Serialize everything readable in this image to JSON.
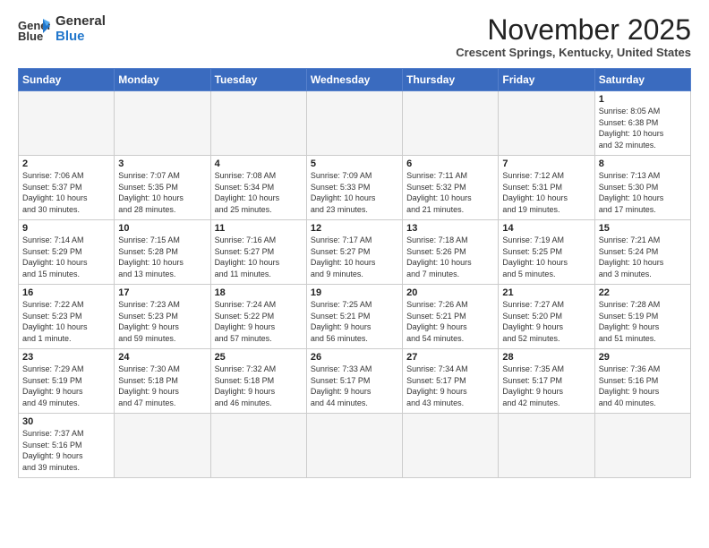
{
  "logo": {
    "line1": "General",
    "line2": "Blue"
  },
  "title": "November 2025",
  "location": "Crescent Springs, Kentucky, United States",
  "days_of_week": [
    "Sunday",
    "Monday",
    "Tuesday",
    "Wednesday",
    "Thursday",
    "Friday",
    "Saturday"
  ],
  "weeks": [
    [
      {
        "day": "",
        "info": "",
        "empty": true
      },
      {
        "day": "",
        "info": "",
        "empty": true
      },
      {
        "day": "",
        "info": "",
        "empty": true
      },
      {
        "day": "",
        "info": "",
        "empty": true
      },
      {
        "day": "",
        "info": "",
        "empty": true
      },
      {
        "day": "",
        "info": "",
        "empty": true
      },
      {
        "day": "1",
        "info": "Sunrise: 8:05 AM\nSunset: 6:38 PM\nDaylight: 10 hours\nand 32 minutes."
      }
    ],
    [
      {
        "day": "2",
        "info": "Sunrise: 7:06 AM\nSunset: 5:37 PM\nDaylight: 10 hours\nand 30 minutes."
      },
      {
        "day": "3",
        "info": "Sunrise: 7:07 AM\nSunset: 5:35 PM\nDaylight: 10 hours\nand 28 minutes."
      },
      {
        "day": "4",
        "info": "Sunrise: 7:08 AM\nSunset: 5:34 PM\nDaylight: 10 hours\nand 25 minutes."
      },
      {
        "day": "5",
        "info": "Sunrise: 7:09 AM\nSunset: 5:33 PM\nDaylight: 10 hours\nand 23 minutes."
      },
      {
        "day": "6",
        "info": "Sunrise: 7:11 AM\nSunset: 5:32 PM\nDaylight: 10 hours\nand 21 minutes."
      },
      {
        "day": "7",
        "info": "Sunrise: 7:12 AM\nSunset: 5:31 PM\nDaylight: 10 hours\nand 19 minutes."
      },
      {
        "day": "8",
        "info": "Sunrise: 7:13 AM\nSunset: 5:30 PM\nDaylight: 10 hours\nand 17 minutes."
      }
    ],
    [
      {
        "day": "9",
        "info": "Sunrise: 7:14 AM\nSunset: 5:29 PM\nDaylight: 10 hours\nand 15 minutes."
      },
      {
        "day": "10",
        "info": "Sunrise: 7:15 AM\nSunset: 5:28 PM\nDaylight: 10 hours\nand 13 minutes."
      },
      {
        "day": "11",
        "info": "Sunrise: 7:16 AM\nSunset: 5:27 PM\nDaylight: 10 hours\nand 11 minutes."
      },
      {
        "day": "12",
        "info": "Sunrise: 7:17 AM\nSunset: 5:27 PM\nDaylight: 10 hours\nand 9 minutes."
      },
      {
        "day": "13",
        "info": "Sunrise: 7:18 AM\nSunset: 5:26 PM\nDaylight: 10 hours\nand 7 minutes."
      },
      {
        "day": "14",
        "info": "Sunrise: 7:19 AM\nSunset: 5:25 PM\nDaylight: 10 hours\nand 5 minutes."
      },
      {
        "day": "15",
        "info": "Sunrise: 7:21 AM\nSunset: 5:24 PM\nDaylight: 10 hours\nand 3 minutes."
      }
    ],
    [
      {
        "day": "16",
        "info": "Sunrise: 7:22 AM\nSunset: 5:23 PM\nDaylight: 10 hours\nand 1 minute."
      },
      {
        "day": "17",
        "info": "Sunrise: 7:23 AM\nSunset: 5:23 PM\nDaylight: 9 hours\nand 59 minutes."
      },
      {
        "day": "18",
        "info": "Sunrise: 7:24 AM\nSunset: 5:22 PM\nDaylight: 9 hours\nand 57 minutes."
      },
      {
        "day": "19",
        "info": "Sunrise: 7:25 AM\nSunset: 5:21 PM\nDaylight: 9 hours\nand 56 minutes."
      },
      {
        "day": "20",
        "info": "Sunrise: 7:26 AM\nSunset: 5:21 PM\nDaylight: 9 hours\nand 54 minutes."
      },
      {
        "day": "21",
        "info": "Sunrise: 7:27 AM\nSunset: 5:20 PM\nDaylight: 9 hours\nand 52 minutes."
      },
      {
        "day": "22",
        "info": "Sunrise: 7:28 AM\nSunset: 5:19 PM\nDaylight: 9 hours\nand 51 minutes."
      }
    ],
    [
      {
        "day": "23",
        "info": "Sunrise: 7:29 AM\nSunset: 5:19 PM\nDaylight: 9 hours\nand 49 minutes."
      },
      {
        "day": "24",
        "info": "Sunrise: 7:30 AM\nSunset: 5:18 PM\nDaylight: 9 hours\nand 47 minutes."
      },
      {
        "day": "25",
        "info": "Sunrise: 7:32 AM\nSunset: 5:18 PM\nDaylight: 9 hours\nand 46 minutes."
      },
      {
        "day": "26",
        "info": "Sunrise: 7:33 AM\nSunset: 5:17 PM\nDaylight: 9 hours\nand 44 minutes."
      },
      {
        "day": "27",
        "info": "Sunrise: 7:34 AM\nSunset: 5:17 PM\nDaylight: 9 hours\nand 43 minutes."
      },
      {
        "day": "28",
        "info": "Sunrise: 7:35 AM\nSunset: 5:17 PM\nDaylight: 9 hours\nand 42 minutes."
      },
      {
        "day": "29",
        "info": "Sunrise: 7:36 AM\nSunset: 5:16 PM\nDaylight: 9 hours\nand 40 minutes."
      }
    ],
    [
      {
        "day": "30",
        "info": "Sunrise: 7:37 AM\nSunset: 5:16 PM\nDaylight: 9 hours\nand 39 minutes."
      },
      {
        "day": "",
        "info": "",
        "empty": true
      },
      {
        "day": "",
        "info": "",
        "empty": true
      },
      {
        "day": "",
        "info": "",
        "empty": true
      },
      {
        "day": "",
        "info": "",
        "empty": true
      },
      {
        "day": "",
        "info": "",
        "empty": true
      },
      {
        "day": "",
        "info": "",
        "empty": true
      }
    ]
  ]
}
